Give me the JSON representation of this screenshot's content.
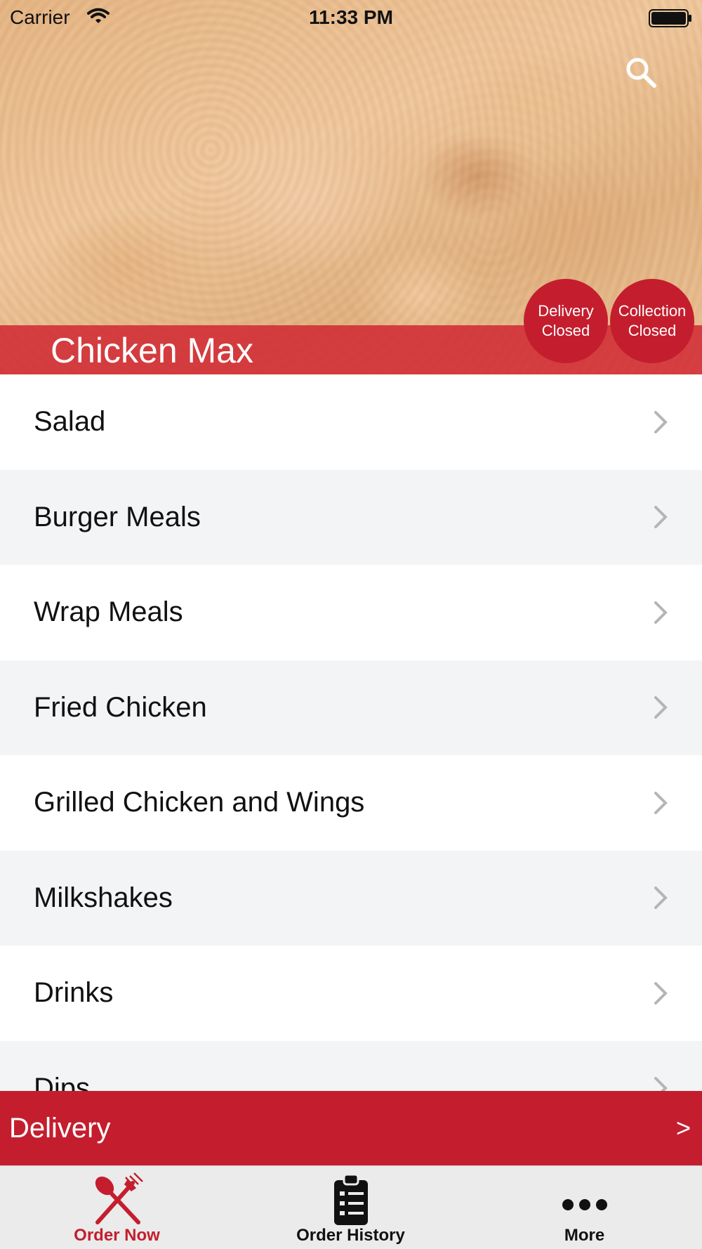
{
  "status_bar": {
    "carrier": "Carrier",
    "time": "11:33 PM"
  },
  "header": {
    "store_name": "Chicken Max",
    "search_icon": "search-icon",
    "delivery_status": {
      "line1": "Delivery",
      "line2": "Closed"
    },
    "collection_status": {
      "line1": "Collection",
      "line2": "Closed"
    }
  },
  "menu": {
    "items": [
      {
        "label": "Salad"
      },
      {
        "label": "Burger Meals"
      },
      {
        "label": "Wrap Meals"
      },
      {
        "label": "Fried Chicken"
      },
      {
        "label": "Grilled Chicken and Wings"
      },
      {
        "label": "Milkshakes"
      },
      {
        "label": "Drinks"
      },
      {
        "label": "Dips"
      }
    ]
  },
  "delivery_bar": {
    "label": "Delivery",
    "arrow": ">"
  },
  "tab_bar": {
    "tabs": [
      {
        "label": "Order Now",
        "icon": "cutlery-icon",
        "active": true
      },
      {
        "label": "Order History",
        "icon": "clipboard-icon",
        "active": false
      },
      {
        "label": "More",
        "icon": "more-dots-icon",
        "active": false
      }
    ]
  },
  "colors": {
    "brand_red": "#c41e2e",
    "row_alt": "#f3f4f6"
  }
}
